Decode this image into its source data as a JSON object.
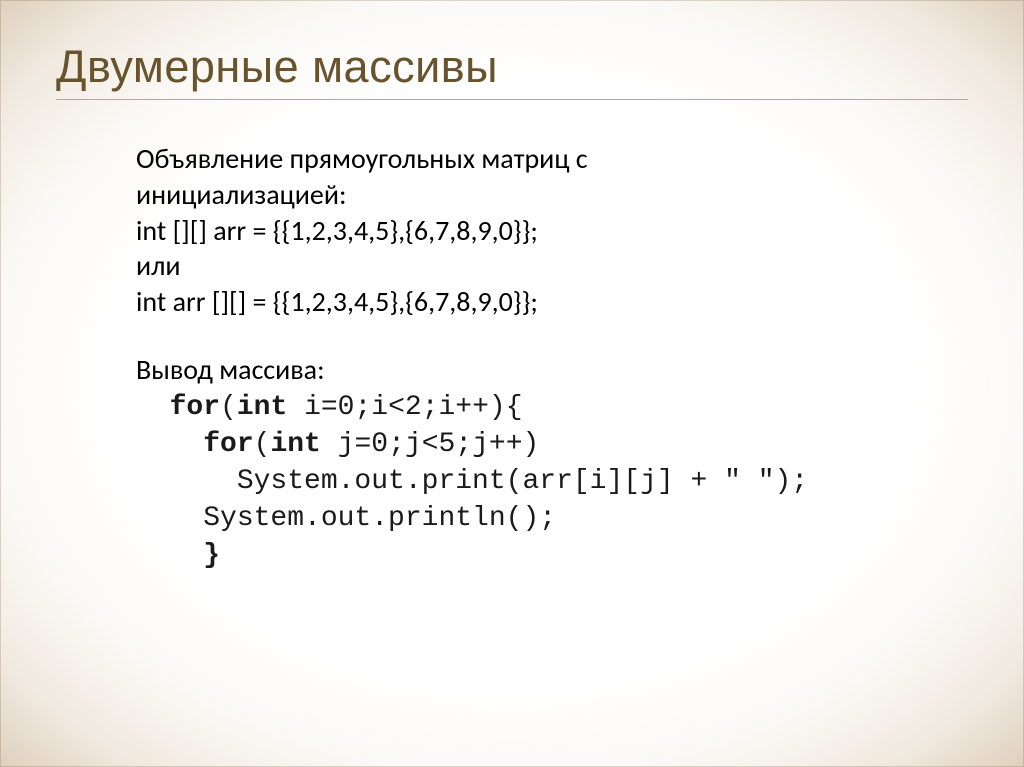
{
  "slide": {
    "title": "Двумерные массивы",
    "intro": {
      "line1": "Объявление прямоугольных матриц с",
      "line2": "инициализацией:",
      "code1": "int [][] arr = {{1,2,3,4,5},{6,7,8,9,0}};",
      "or": "или",
      "code2": "int arr [][] = {{1,2,3,4,5},{6,7,8,9,0}};",
      "output_label": "Вывод массива:"
    },
    "code": {
      "l1_pre": "  ",
      "l1_kw": "for",
      "l1_mid": "(",
      "l1_kw2": "int",
      "l1_rest": " i=0;i<2;i++){",
      "l2_pre": "    ",
      "l2_kw": "for",
      "l2_mid": "(",
      "l2_kw2": "int",
      "l2_rest": " j=0;j<5;j++)",
      "l3": "      System.out.print(arr[i][j] + \" \");",
      "l4": "    System.out.println();",
      "l5_pre": "    ",
      "l5_brace": "}"
    }
  }
}
